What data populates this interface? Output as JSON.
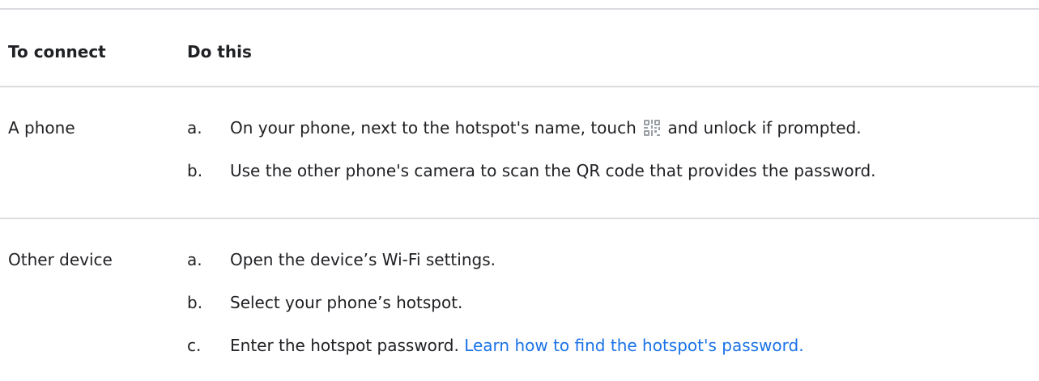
{
  "table": {
    "header": {
      "col1": "To connect",
      "col2": "Do this"
    },
    "rows": [
      {
        "label": "A phone",
        "steps": [
          {
            "marker": "a.",
            "text_before": "On your phone, next to the hotspot's name, touch",
            "icon": "qr-code-icon",
            "text_after": "and unlock if prompted."
          },
          {
            "marker": "b.",
            "text": "Use the other phone's camera to scan the QR code that provides the password."
          }
        ]
      },
      {
        "label": "Other device",
        "steps": [
          {
            "marker": "a.",
            "text": "Open the device’s Wi-Fi settings."
          },
          {
            "marker": "b.",
            "text": "Select your phone’s hotspot."
          },
          {
            "marker": "c.",
            "text": "Enter the hotspot password.",
            "link": "Learn how to find the hotspot's password."
          }
        ]
      }
    ]
  },
  "colors": {
    "text": "#202124",
    "link": "#1a73e8",
    "divider": "#dadce0",
    "icon": "#9aa0a6"
  }
}
